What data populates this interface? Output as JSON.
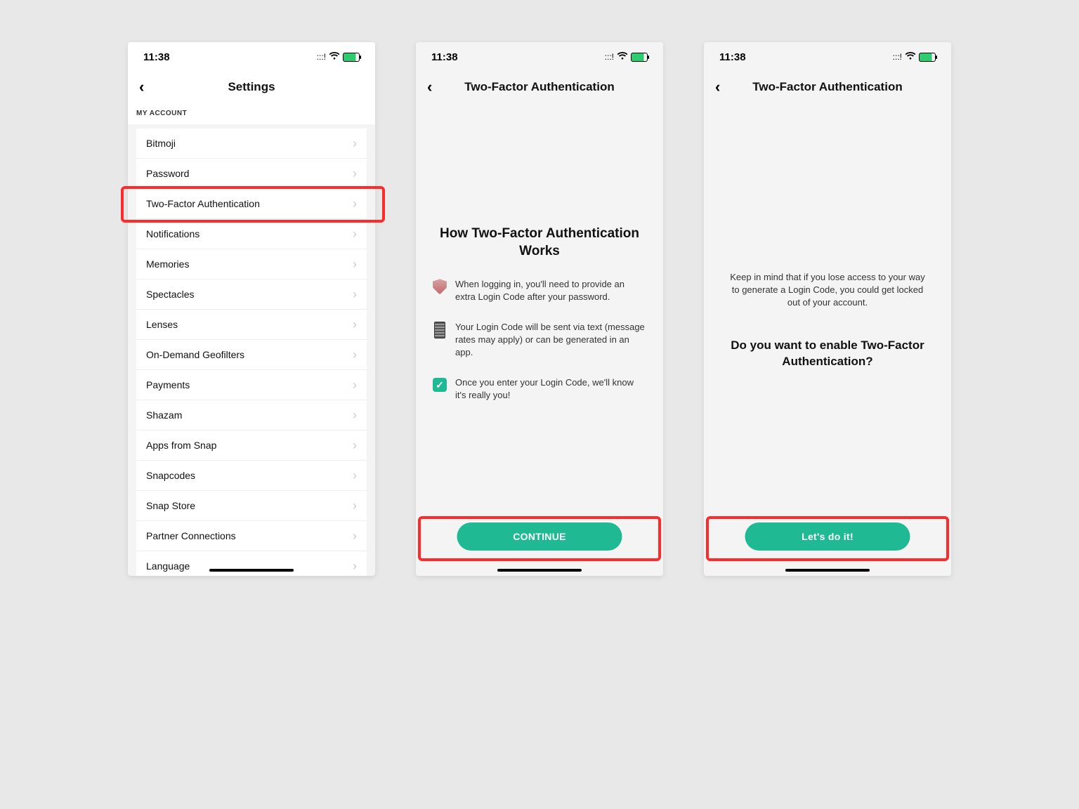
{
  "status": {
    "time": "11:38"
  },
  "screen1": {
    "title": "Settings",
    "section_label": "MY ACCOUNT",
    "rows": [
      {
        "label": "Bitmoji"
      },
      {
        "label": "Password"
      },
      {
        "label": "Two-Factor Authentication",
        "highlight": true
      },
      {
        "label": "Notifications"
      },
      {
        "label": "Memories"
      },
      {
        "label": "Spectacles"
      },
      {
        "label": "Lenses"
      },
      {
        "label": "On-Demand Geofilters"
      },
      {
        "label": "Payments"
      },
      {
        "label": "Shazam"
      },
      {
        "label": "Apps from Snap"
      },
      {
        "label": "Snapcodes"
      },
      {
        "label": "Snap Store"
      },
      {
        "label": "Partner Connections"
      },
      {
        "label": "Language"
      }
    ]
  },
  "screen2": {
    "title": "Two-Factor Authentication",
    "heading": "How Two-Factor Authentication Works",
    "items": [
      {
        "text": "When logging in, you'll need to provide an extra Login Code after your password.",
        "icon": "shield"
      },
      {
        "text": "Your Login Code will be sent via text (message rates may apply) or can be generated in an app.",
        "icon": "phone"
      },
      {
        "text": "Once you enter your Login Code, we'll know it's really you!",
        "icon": "check"
      }
    ],
    "cta": "CONTINUE"
  },
  "screen3": {
    "title": "Two-Factor Authentication",
    "warning": "Keep in mind that if you lose access to your way to generate a Login Code, you could get locked out of your account.",
    "prompt": "Do you want to enable Two-Factor Authentication?",
    "cta": "Let's do it!"
  },
  "colors": {
    "highlight": "#ff2b2b",
    "cta": "#1fb993"
  }
}
